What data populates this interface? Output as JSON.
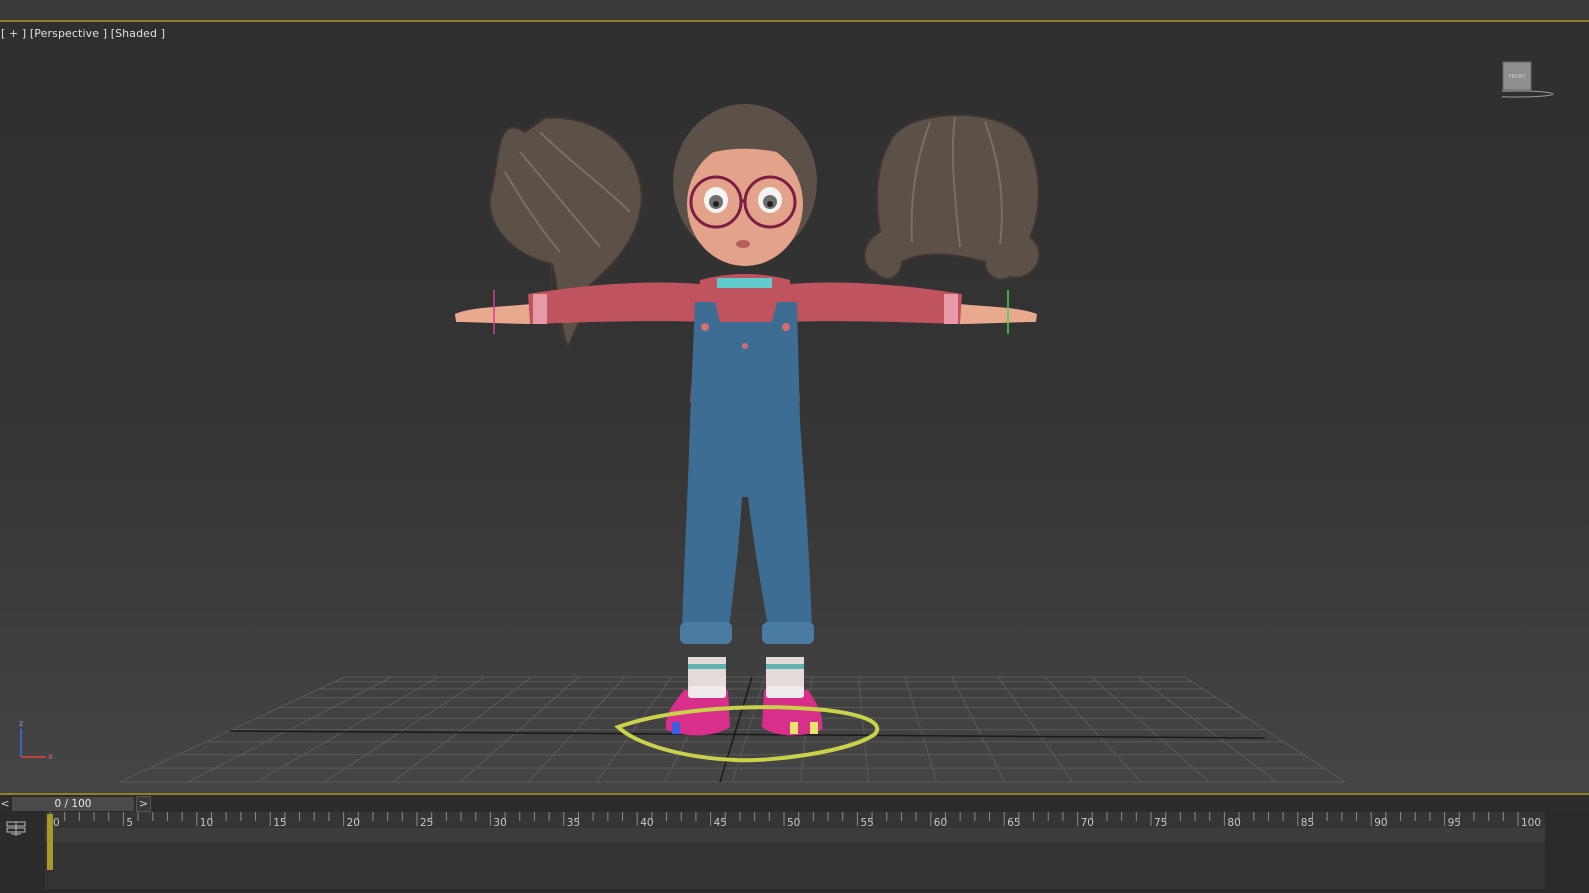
{
  "viewport": {
    "label_parts": [
      "[ + ]",
      "[Perspective ]",
      "[Shaded ]"
    ],
    "viewcube_face": "FRONT",
    "axis_labels": {
      "z": "z",
      "x": "x"
    }
  },
  "time_slider": {
    "value": "0 / 100",
    "current_frame": 0,
    "total_frames": 100,
    "prev_label": "<",
    "next_label": ">"
  },
  "timeline": {
    "start": 0,
    "end": 100,
    "label_step": 5,
    "ruler_labels": [
      "0",
      "5",
      "10",
      "15",
      "20",
      "25",
      "30",
      "35",
      "40",
      "45",
      "50",
      "55",
      "60",
      "65",
      "70",
      "75",
      "80",
      "85",
      "90",
      "95",
      "100"
    ]
  },
  "colors": {
    "accent_border": "#8c7f2a",
    "frame_marker": "#a59a2a",
    "grid": "#555555",
    "shirt": "#c0545e",
    "denim": "#3d6d92",
    "hair": "#5a5048",
    "shoe": "#d8308a",
    "foot_ring": "#c9d24a"
  },
  "icons": {
    "track_toggle": "key-filter-icon",
    "viewcube": "viewcube-icon",
    "axis_tripod": "axis-tripod-icon"
  }
}
